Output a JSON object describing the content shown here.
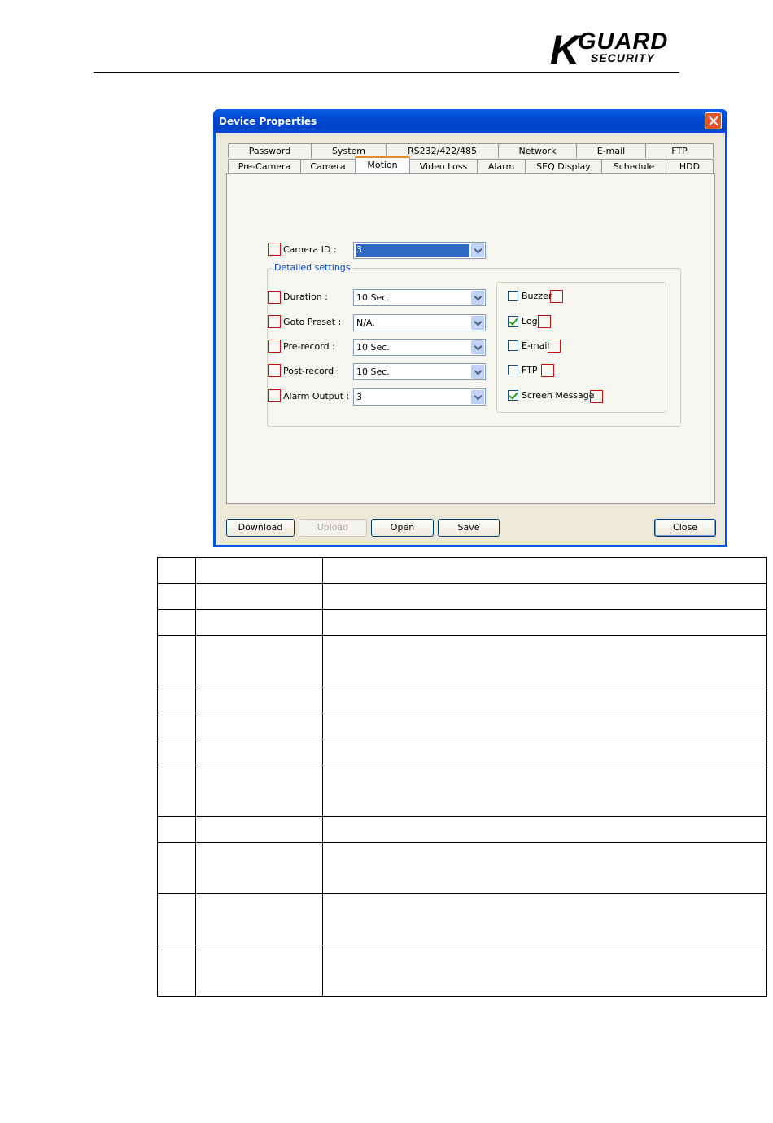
{
  "logo": {
    "k": "K",
    "guard": "GUARD",
    "security": "SECURITY"
  },
  "window": {
    "title": "Device Properties",
    "tabs_row1": [
      "Password",
      "System",
      "RS232/422/485",
      "Network",
      "E-mail",
      "FTP"
    ],
    "tabs_row2": [
      "Pre-Camera",
      "Camera",
      "Motion",
      "Video Loss",
      "Alarm",
      "SEQ Display",
      "Schedule",
      "HDD"
    ],
    "active_tab": "Motion"
  },
  "form": {
    "camera_id": {
      "label": "Camera ID :",
      "value": "3"
    },
    "group_label": "Detailed settings",
    "fields": [
      {
        "label": "Duration :",
        "value": "10 Sec."
      },
      {
        "label": "Goto Preset :",
        "value": "N/A."
      },
      {
        "label": "Pre-record :",
        "value": "10 Sec."
      },
      {
        "label": "Post-record :",
        "value": "10 Sec."
      },
      {
        "label": "Alarm Output :",
        "value": "3"
      }
    ],
    "checkboxes": [
      {
        "label": "Buzzer",
        "checked": false
      },
      {
        "label": "Log",
        "checked": true
      },
      {
        "label": "E-mail",
        "checked": false
      },
      {
        "label": "FTP",
        "checked": false
      },
      {
        "label": "Screen Message",
        "checked": true
      }
    ]
  },
  "buttons": {
    "download": "Download",
    "upload": "Upload",
    "open": "Open",
    "save": "Save",
    "close": "Close"
  },
  "doc_table": {
    "rows": 12,
    "columns": 3
  }
}
